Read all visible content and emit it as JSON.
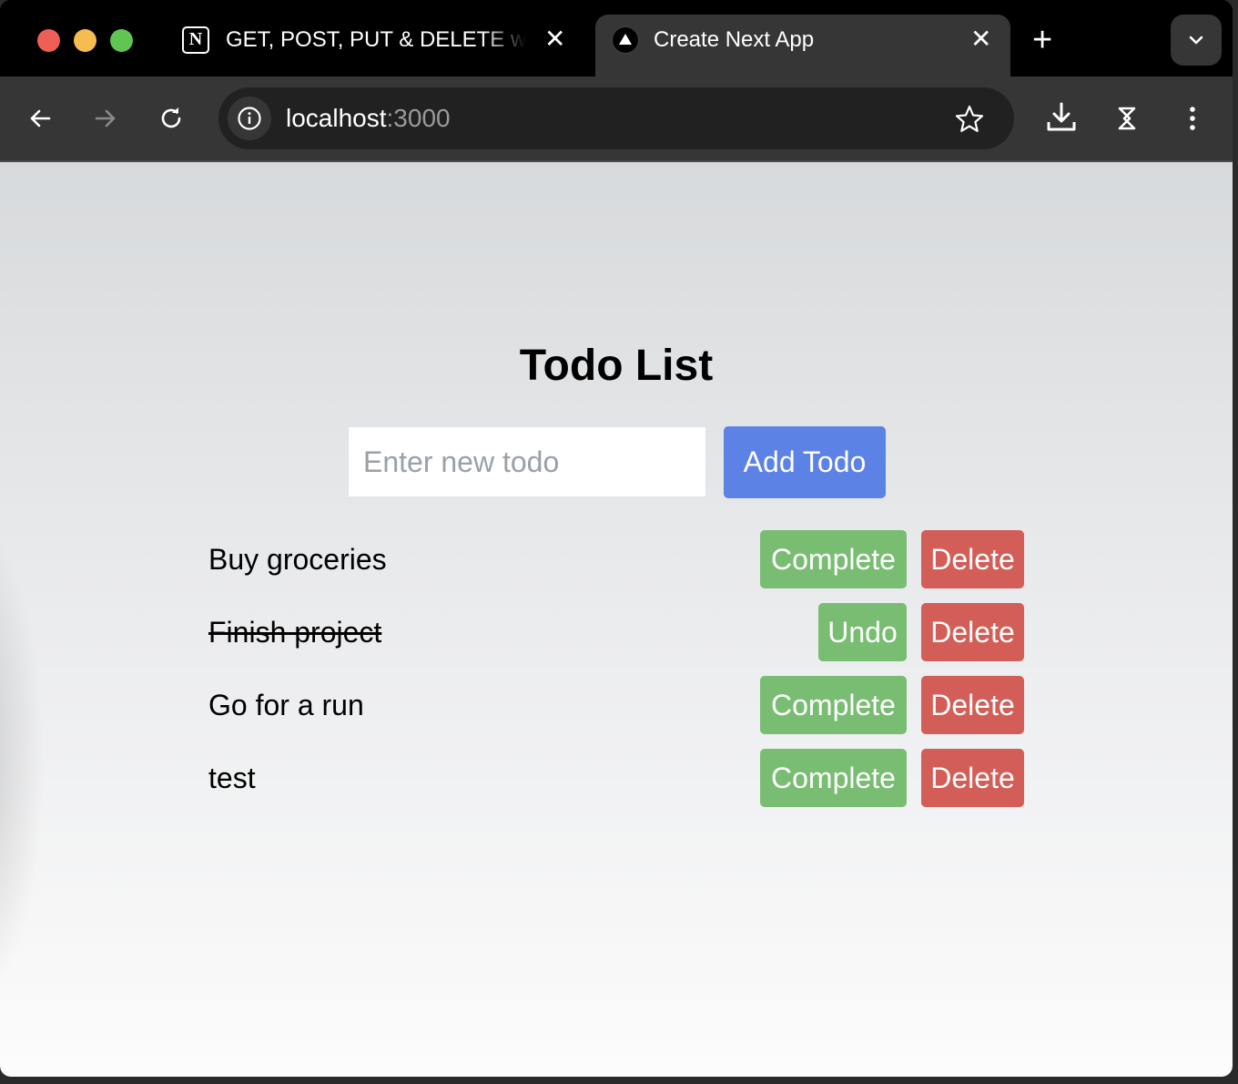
{
  "browser": {
    "tabs": [
      {
        "title": "GET, POST, PUT & DELETE with Next.js",
        "close": "✕"
      },
      {
        "title": "Create Next App",
        "close": "✕"
      }
    ],
    "new_tab": "+",
    "url_host": "localhost",
    "url_port": ":3000"
  },
  "page": {
    "title": "Todo List",
    "input_placeholder": "Enter new todo",
    "add_button": "Add Todo",
    "todos": [
      {
        "text": "Buy groceries",
        "completed": false,
        "action": "Complete",
        "delete": "Delete"
      },
      {
        "text": "Finish project",
        "completed": true,
        "action": "Undo",
        "delete": "Delete"
      },
      {
        "text": "Go for a run",
        "completed": false,
        "action": "Complete",
        "delete": "Delete"
      },
      {
        "text": "test",
        "completed": false,
        "action": "Complete",
        "delete": "Delete"
      }
    ]
  },
  "colors": {
    "add_button": "#5d82e6",
    "complete_button": "#79bd72",
    "delete_button": "#d25e57"
  },
  "icons": [
    "back-arrow-icon",
    "forward-arrow-icon",
    "reload-icon",
    "info-icon",
    "star-icon",
    "download-icon",
    "extension-icon",
    "more-menu-icon",
    "chevron-down-icon"
  ]
}
